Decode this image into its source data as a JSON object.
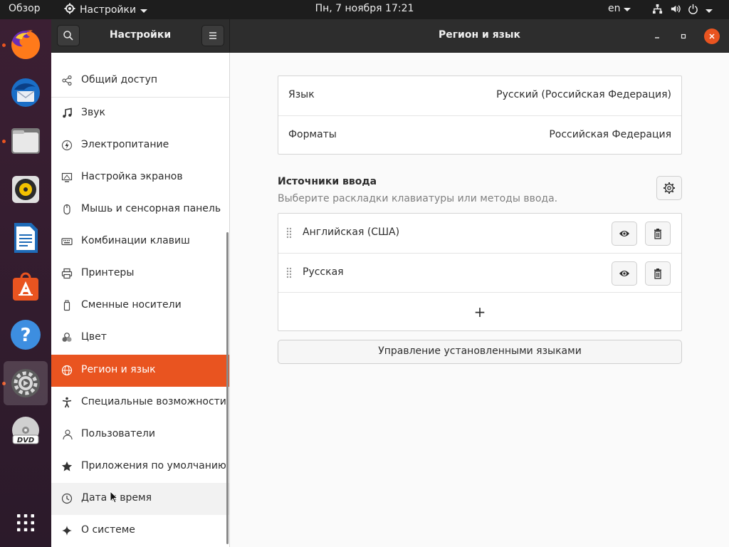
{
  "topbar": {
    "activities": "Обзор",
    "app_menu": "Настройки",
    "clock": "Пн, 7 ноября  17:21",
    "language": "en",
    "system_icons": [
      "network-icon",
      "volume-icon",
      "power-icon"
    ]
  },
  "dock": {
    "apps": [
      {
        "name": "firefox",
        "running": true
      },
      {
        "name": "thunderbird",
        "running": false
      },
      {
        "name": "files",
        "running": true
      },
      {
        "name": "rhythmbox",
        "running": false
      },
      {
        "name": "libreoffice-writer",
        "running": false
      },
      {
        "name": "ubuntu-software",
        "running": false
      },
      {
        "name": "help",
        "running": false
      },
      {
        "name": "settings",
        "running": true,
        "active": true
      },
      {
        "name": "dvd",
        "running": false
      }
    ],
    "show_apps_icon": "grid-icon"
  },
  "window": {
    "sidebar_title": "Настройки",
    "main_title": "Регион и язык"
  },
  "sidebar": {
    "items": [
      {
        "label": "Общий доступ",
        "icon": "share-icon"
      },
      {
        "label": "Звук",
        "icon": "music-note-icon"
      },
      {
        "label": "Электропитание",
        "icon": "power-icon"
      },
      {
        "label": "Настройка экранов",
        "icon": "display-icon"
      },
      {
        "label": "Мышь и сенсорная панель",
        "icon": "mouse-icon"
      },
      {
        "label": "Комбинации клавиш",
        "icon": "keyboard-icon"
      },
      {
        "label": "Принтеры",
        "icon": "printer-icon"
      },
      {
        "label": "Сменные носители",
        "icon": "removable-media-icon"
      },
      {
        "label": "Цвет",
        "icon": "color-icon"
      },
      {
        "label": "Регион и язык",
        "icon": "globe-icon",
        "selected": true
      },
      {
        "label": "Специальные возможности",
        "icon": "accessibility-icon"
      },
      {
        "label": "Пользователи",
        "icon": "users-icon"
      },
      {
        "label": "Приложения по умолчанию",
        "icon": "star-icon"
      },
      {
        "label": "Дата и время",
        "icon": "clock-icon"
      },
      {
        "label": "О системе",
        "icon": "sparkle-icon"
      }
    ]
  },
  "region": {
    "language_label": "Язык",
    "language_value": "Русский (Российская Федерация)",
    "formats_label": "Форматы",
    "formats_value": "Российская Федерация"
  },
  "input_sources": {
    "title": "Источники ввода",
    "subtitle": "Выберите раскладки клавиатуры или методы ввода.",
    "sources": [
      {
        "name": "Английская (США)"
      },
      {
        "name": "Русская"
      }
    ],
    "add_label": "+",
    "manage_button": "Управление установленными языками"
  },
  "colors": {
    "accent": "#e95420",
    "topbar_bg": "#1d1d1d",
    "headerbar_bg": "#2d2d2d"
  }
}
